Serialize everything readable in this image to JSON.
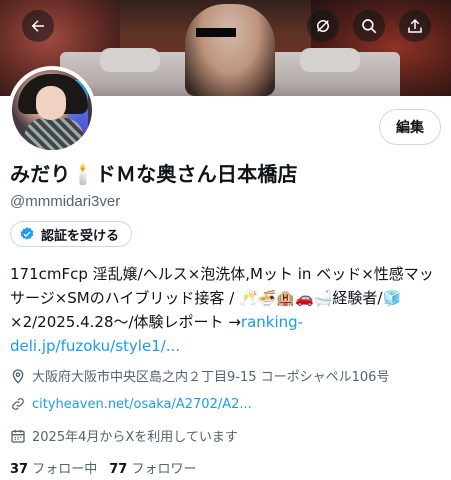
{
  "header": {
    "back_icon": "arrow-left-icon",
    "icons": [
      "mute-icon",
      "search-icon",
      "share-icon"
    ]
  },
  "profile": {
    "edit_label": "編集",
    "name_part1": "みだり",
    "name_emoji": "🕯️",
    "name_part2": "ドＭな奥さん日本橋店",
    "handle": "@mmmidari3ver",
    "verify_label": "認証を受ける",
    "bio_text": "171cmFcp 淫乱嬢/ヘルス×泡洗体,Mット in ベッド×性感マッサージ×SMのハイブリッド接客 / 🥂🍜🏨🚗🛁経験者/🧊×2/2025.4.28～/体験レポート →",
    "bio_link": "ranking-deli.jp/fuzoku/style1/...",
    "location": "大阪府大阪市中央区島之内２丁目9-15 コーポシャペル106号",
    "website": "cityheaven.net/osaka/A2702/A2...",
    "joined": "2025年4月からXを利用しています",
    "following_count": "37",
    "following_label": "フォロー中",
    "followers_count": "77",
    "followers_label": "フォロワー"
  },
  "colors": {
    "link": "#1d9bf0",
    "secondary_text": "#536471",
    "verify_badge": "#1d9bf0"
  }
}
